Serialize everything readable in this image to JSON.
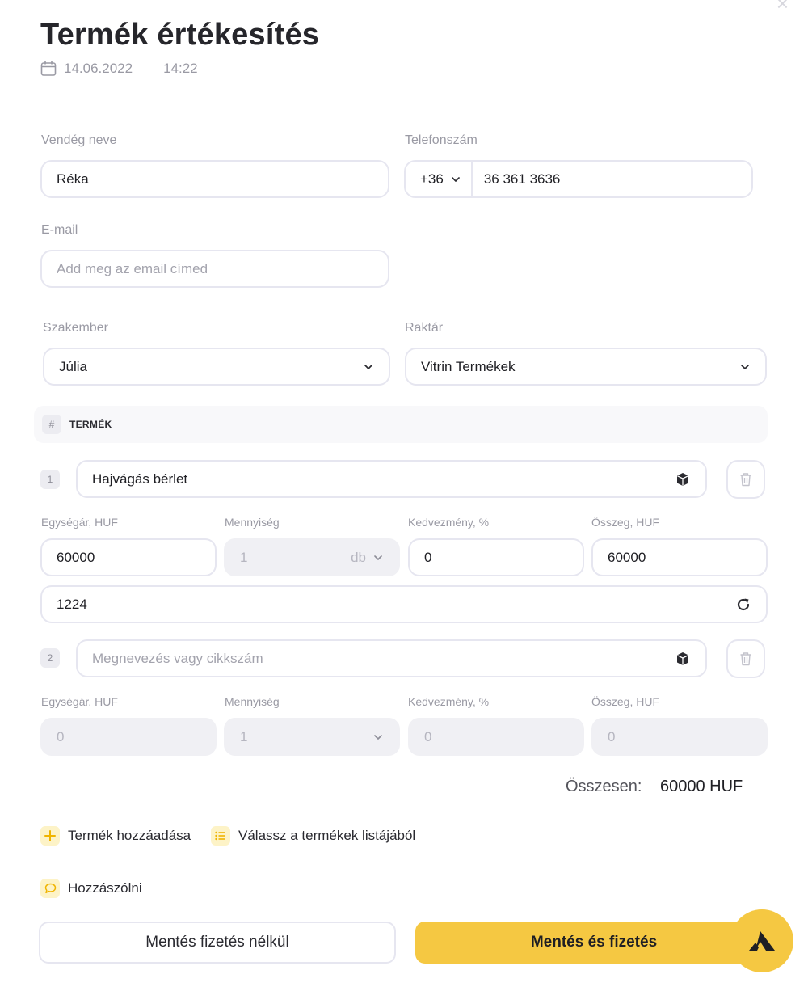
{
  "header": {
    "title": "Termék értékesítés",
    "date": "14.06.2022",
    "time": "14:22"
  },
  "guest": {
    "name_label": "Vendég neve",
    "name_value": "Réka",
    "phone_label": "Telefonszám",
    "phone_prefix": "+36",
    "phone_value": "36 361 3636",
    "email_label": "E-mail",
    "email_placeholder": "Add meg az email címed"
  },
  "staff": {
    "specialist_label": "Szakember",
    "specialist_value": "Júlia",
    "warehouse_label": "Raktár",
    "warehouse_value": "Vitrin Termékek"
  },
  "table": {
    "hash": "#",
    "column": "TERMÉK"
  },
  "items": [
    {
      "index": "1",
      "name": "Hajvágás bérlet",
      "unit_price_label": "Egységár, HUF",
      "unit_price": "60000",
      "quantity_label": "Mennyiség",
      "quantity": "1",
      "unit": "db",
      "discount_label": "Kedvezmény, %",
      "discount": "0",
      "amount_label": "Összeg, HUF",
      "amount": "60000",
      "code": "1224"
    },
    {
      "index": "2",
      "name_placeholder": "Megnevezés vagy cikkszám",
      "unit_price_label": "Egységár, HUF",
      "unit_price": "0",
      "quantity_label": "Mennyiség",
      "quantity": "1",
      "discount_label": "Kedvezmény, %",
      "discount": "0",
      "amount_label": "Összeg, HUF",
      "amount": "0"
    }
  ],
  "total": {
    "label": "Összesen:",
    "value": "60000 HUF"
  },
  "actions": {
    "add_product": "Termék hozzáadása",
    "choose_from_list": "Válassz a termékek listájából",
    "comment": "Hozzászólni"
  },
  "buttons": {
    "save_without_payment": "Mentés fizetés nélkül",
    "save_and_pay": "Mentés és fizetés"
  },
  "colors": {
    "accent": "#f5c842",
    "accent_light": "#fdf3c7",
    "border": "#e6e6f0",
    "disabled_bg": "#f0f0f4"
  }
}
